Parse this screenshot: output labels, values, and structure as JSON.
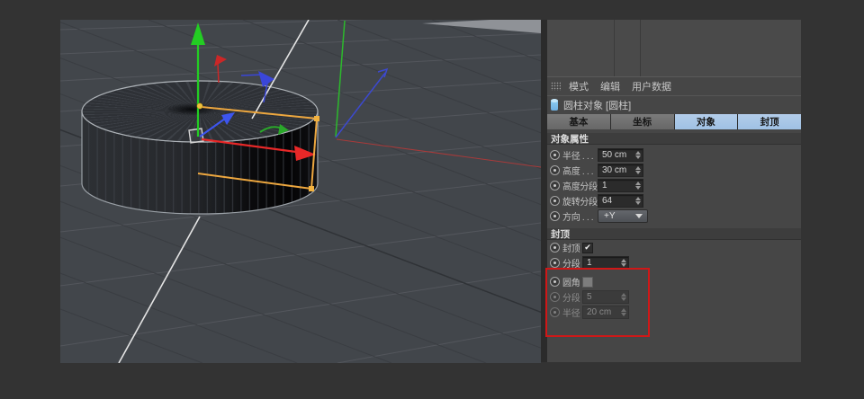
{
  "window": {
    "background": "#333333"
  },
  "viewport": {
    "axis_colors": {
      "x": "#e82828",
      "y": "#23cd23",
      "z": "#3d55ee"
    },
    "handle_color": "#eda73f",
    "annotation_color": "#d01717"
  },
  "panel": {
    "menu": {
      "items": [
        {
          "label": "模式"
        },
        {
          "label": "编辑"
        },
        {
          "label": "用户数据"
        }
      ]
    },
    "object_header": {
      "label": "圆柱对象 [圆柱]",
      "icon": "cylinder-icon"
    },
    "tabs": [
      {
        "label": "基本",
        "active": false
      },
      {
        "label": "坐标",
        "active": false
      },
      {
        "label": "对象",
        "active": true
      },
      {
        "label": "封顶",
        "active": true
      }
    ],
    "glyphs": {
      "check": "✔"
    },
    "sections": [
      {
        "title": "对象属性",
        "rows": [
          {
            "label": "半径 . . .",
            "value": "50 cm",
            "control": "number",
            "highlighted": true
          },
          {
            "label": "高度 . . .",
            "value": "30 cm",
            "control": "number",
            "highlighted": true
          },
          {
            "label": "高度分段",
            "value": "1",
            "control": "number",
            "highlighted": true
          },
          {
            "label": "旋转分段",
            "value": "64",
            "control": "number",
            "highlighted": true
          },
          {
            "label": "方向 . . .",
            "value": "+Y",
            "control": "dropdown"
          }
        ]
      },
      {
        "title": "封顶",
        "rows": [
          {
            "label": "封顶",
            "control": "checkbox",
            "checked": true
          },
          {
            "label": "分段",
            "value": "1",
            "control": "number"
          },
          {
            "label": "圆角",
            "control": "checkbox",
            "checked": false
          },
          {
            "label": "分段",
            "value": "5",
            "control": "number",
            "disabled": true
          },
          {
            "label": "半径",
            "value": "20 cm",
            "control": "number",
            "disabled": true
          }
        ]
      }
    ]
  }
}
